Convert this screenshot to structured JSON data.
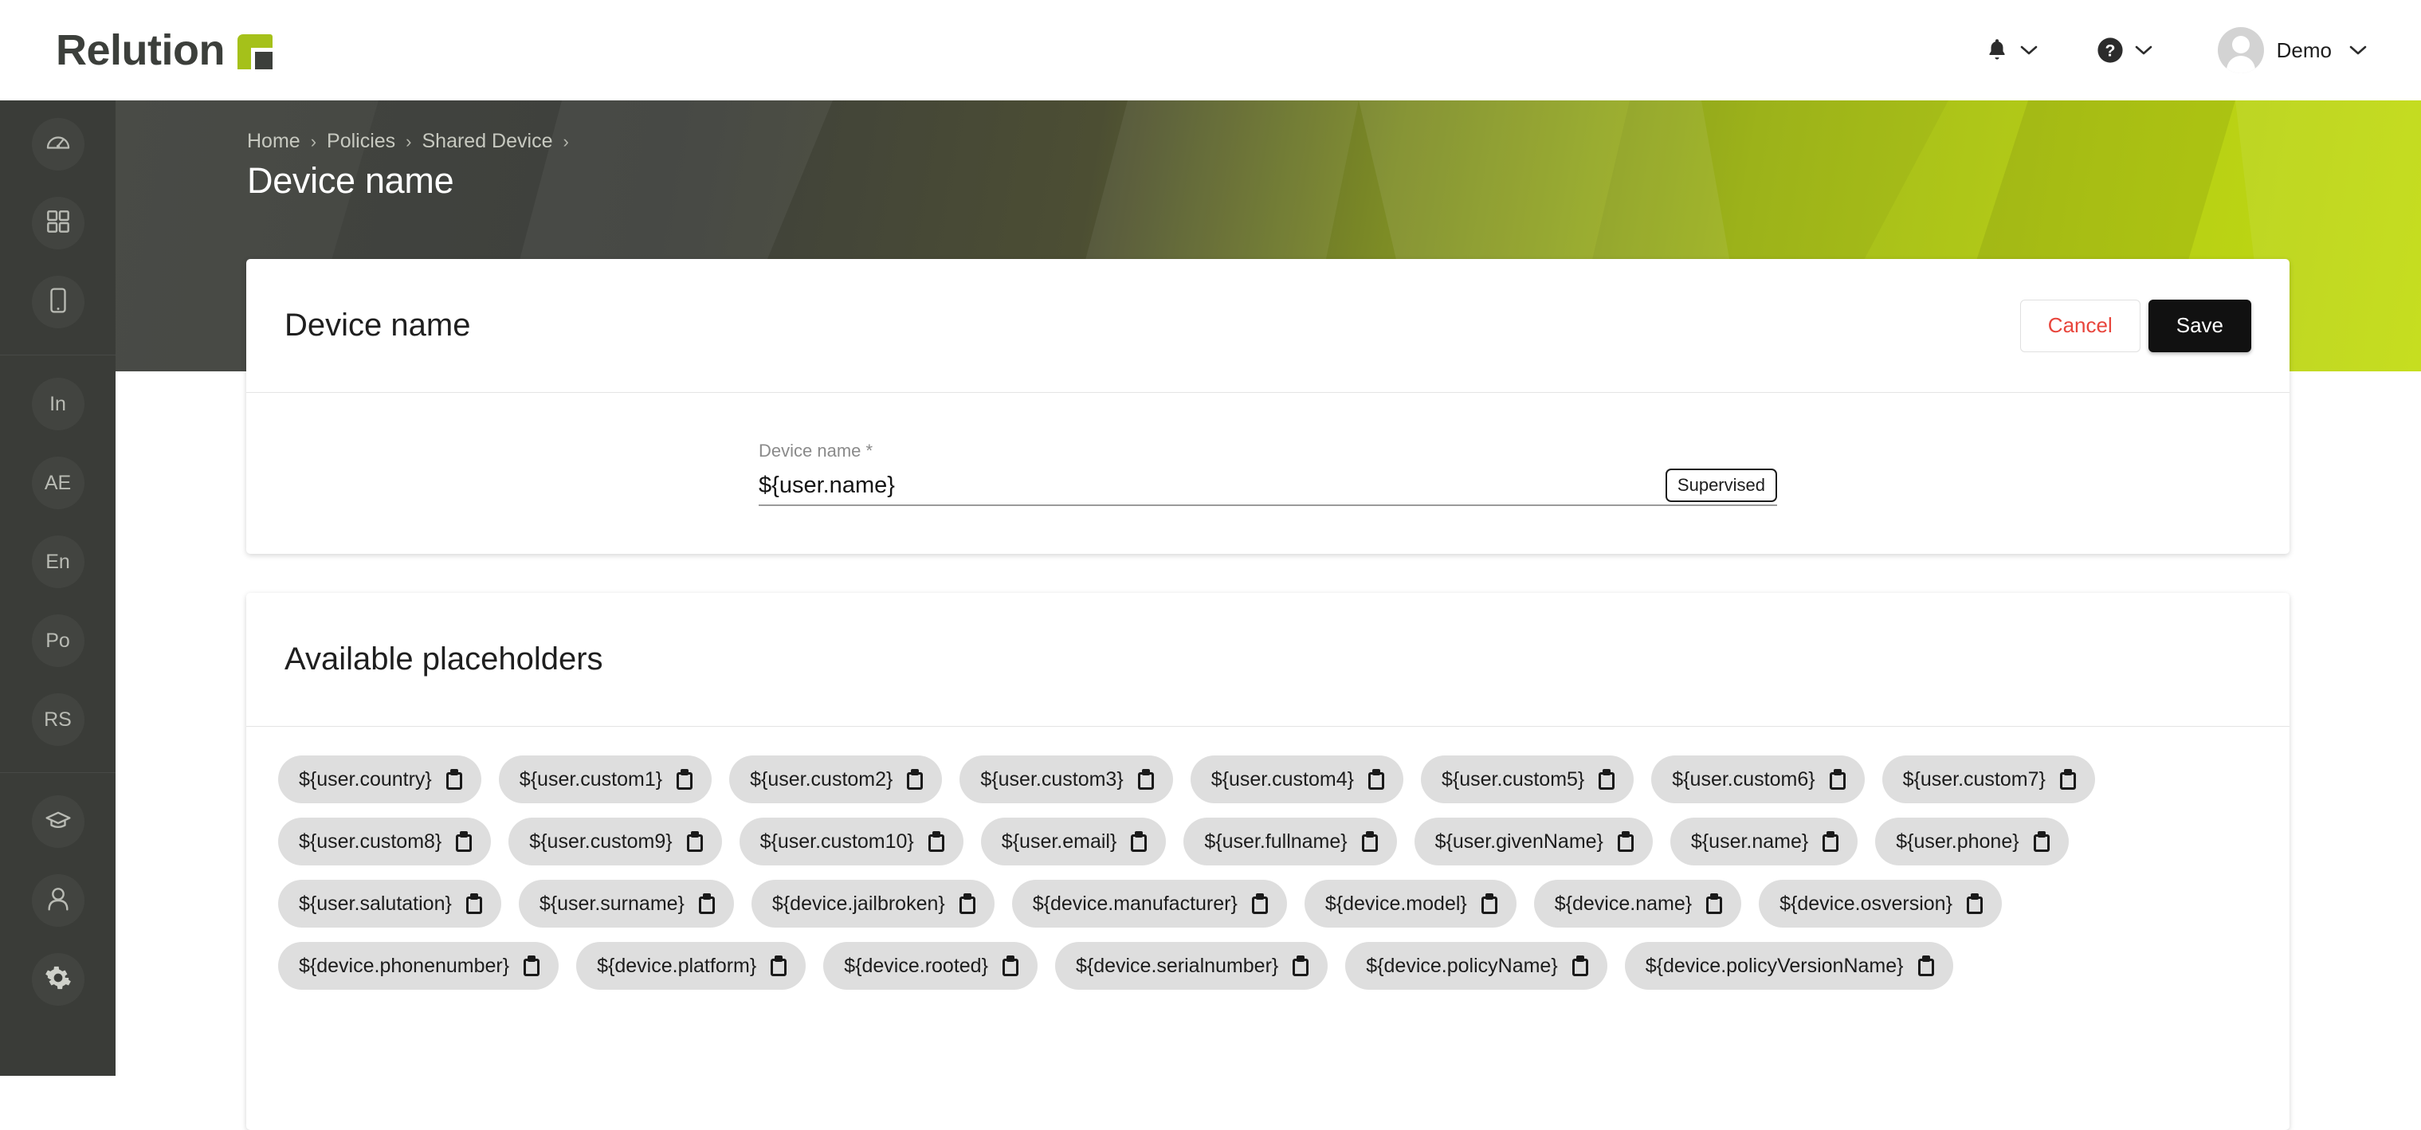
{
  "header": {
    "brand_name": "Relution",
    "brand_logo_icon": "relution-logo-icon",
    "notifications_icon": "bell-icon",
    "help_icon": "question-circle-icon",
    "chevron_icon": "chevron-down-icon",
    "avatar_icon": "user-avatar-icon",
    "user_name": "Demo"
  },
  "sidebar": {
    "items": [
      {
        "id": "dashboard",
        "type": "icon",
        "icon": "speedometer-icon",
        "label": ""
      },
      {
        "id": "apps",
        "type": "icon",
        "icon": "grid-icon",
        "label": ""
      },
      {
        "id": "devices",
        "type": "icon",
        "icon": "mobile-device-icon",
        "label": ""
      },
      {
        "id": "inventory",
        "type": "text",
        "icon": "",
        "label": "In"
      },
      {
        "id": "android-enterprise",
        "type": "text",
        "icon": "",
        "label": "AE"
      },
      {
        "id": "enrollment",
        "type": "text",
        "icon": "",
        "label": "En"
      },
      {
        "id": "policies",
        "type": "text",
        "icon": "",
        "label": "Po"
      },
      {
        "id": "reports-settings",
        "type": "text",
        "icon": "",
        "label": "RS"
      },
      {
        "id": "academy",
        "type": "icon",
        "icon": "graduation-cap-icon",
        "label": ""
      },
      {
        "id": "users",
        "type": "icon",
        "icon": "user-icon",
        "label": ""
      },
      {
        "id": "settings",
        "type": "icon",
        "icon": "gear-icon",
        "label": ""
      }
    ]
  },
  "hero": {
    "breadcrumbs": [
      "Home",
      "Policies",
      "Shared Device"
    ],
    "separator": "›",
    "trailing_separator": "›",
    "page_title": "Device name"
  },
  "form_card": {
    "title": "Device name",
    "cancel_label": "Cancel",
    "save_label": "Save",
    "field": {
      "label": "Device name *",
      "value": "${user.name}",
      "badge": "Supervised"
    }
  },
  "placeholders_card": {
    "title": "Available placeholders",
    "copy_icon": "clipboard-copy-icon",
    "rows": [
      [
        "${user.country}",
        "${user.custom1}",
        "${user.custom2}",
        "${user.custom3}",
        "${user.custom4}",
        "${user.custom5}",
        "${user.custom6}",
        "${user.custom7}"
      ],
      [
        "${user.custom8}",
        "${user.custom9}",
        "${user.custom10}",
        "${user.email}",
        "${user.fullname}",
        "${user.givenName}",
        "${user.name}",
        "${user.phone}"
      ],
      [
        "${user.salutation}",
        "${user.surname}",
        "${device.jailbroken}",
        "${device.manufacturer}",
        "${device.model}",
        "${device.name}",
        "${device.osversion}"
      ],
      [
        "${device.phonenumber}",
        "${device.platform}",
        "${device.rooted}",
        "${device.serialnumber}",
        "${device.policyName}",
        "${device.policyVersionName}"
      ]
    ]
  },
  "colors": {
    "brand_green": "#a5c11a",
    "sidebar_bg": "#3a3c38",
    "save_bg": "#111111",
    "cancel_text": "#e8453c",
    "chip_bg": "#dedede"
  }
}
